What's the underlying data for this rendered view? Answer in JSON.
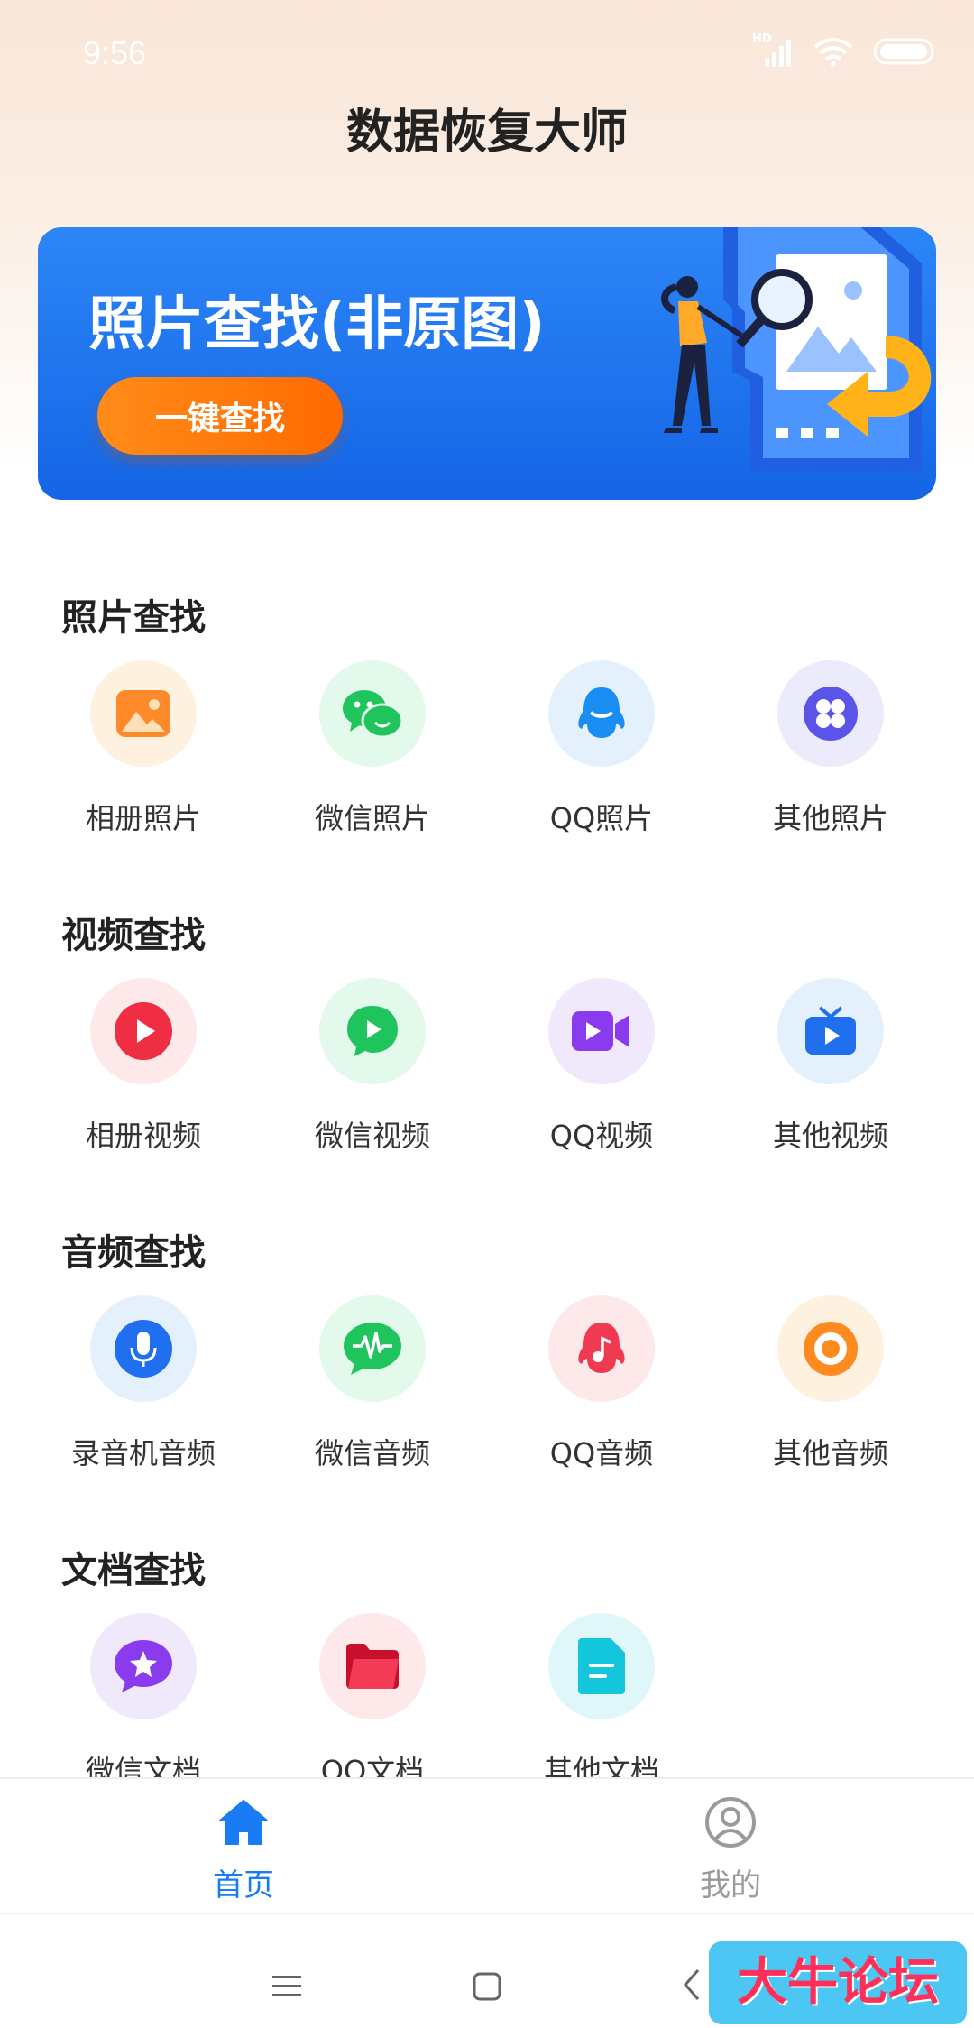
{
  "status_bar": {
    "time": "9:56",
    "hd_label": "HD"
  },
  "app": {
    "title": "数据恢复大师"
  },
  "banner": {
    "title": "照片查找(非原图)",
    "button_label": "一键查找"
  },
  "sections": [
    {
      "title": "照片查找",
      "items": [
        {
          "label": "相册照片",
          "icon": "gallery-photo-icon",
          "bg": "#fff1df"
        },
        {
          "label": "微信照片",
          "icon": "wechat-icon",
          "bg": "#e3f9ec"
        },
        {
          "label": "QQ照片",
          "icon": "qq-penguin-icon",
          "bg": "#e4f1fd"
        },
        {
          "label": "其他照片",
          "icon": "four-petal-icon",
          "bg": "#ecebfb"
        }
      ]
    },
    {
      "title": "视频查找",
      "items": [
        {
          "label": "相册视频",
          "icon": "play-circle-icon",
          "bg": "#fde8ea"
        },
        {
          "label": "微信视频",
          "icon": "chat-play-icon",
          "bg": "#e3f9ec"
        },
        {
          "label": "QQ视频",
          "icon": "video-camera-icon",
          "bg": "#f0e8fb"
        },
        {
          "label": "其他视频",
          "icon": "tv-play-icon",
          "bg": "#e4f1fd"
        }
      ]
    },
    {
      "title": "音频查找",
      "items": [
        {
          "label": "录音机音频",
          "icon": "microphone-icon",
          "bg": "#e4f1fd"
        },
        {
          "label": "微信音频",
          "icon": "chat-waveform-icon",
          "bg": "#e3f9ec"
        },
        {
          "label": "QQ音频",
          "icon": "qq-music-icon",
          "bg": "#fde8ea"
        },
        {
          "label": "其他音频",
          "icon": "record-icon",
          "bg": "#fff1df"
        }
      ]
    },
    {
      "title": "文档查找",
      "items": [
        {
          "label": "微信文档",
          "icon": "chat-star-icon",
          "bg": "#f0e8fb"
        },
        {
          "label": "QQ文档",
          "icon": "folder-icon",
          "bg": "#fde8ea"
        },
        {
          "label": "其他文档",
          "icon": "document-icon",
          "bg": "#e0f7fa"
        }
      ]
    }
  ],
  "tabbar": {
    "home_label": "首页",
    "mine_label": "我的",
    "active_color": "#1a7cf5",
    "inactive_color": "#9a9a9a"
  },
  "watermark": {
    "text": "大牛论坛"
  }
}
